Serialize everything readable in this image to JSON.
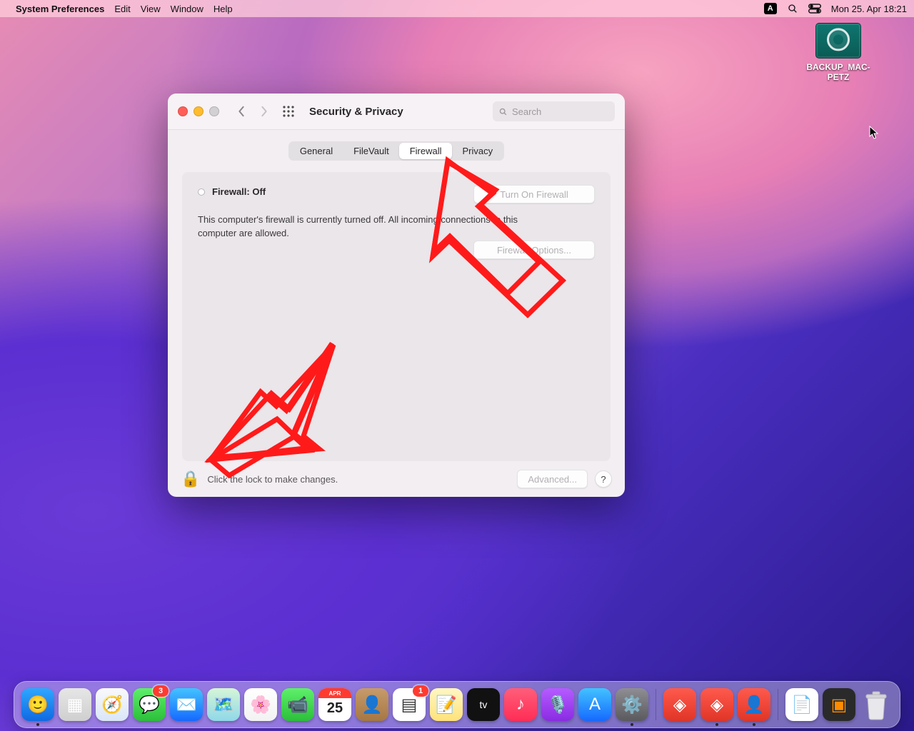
{
  "menubar": {
    "app_name": "System Preferences",
    "items": [
      "Edit",
      "View",
      "Window",
      "Help"
    ],
    "right": {
      "datetime": "Mon 25. Apr  18:21"
    }
  },
  "desktop_icons": [
    {
      "label": "BACKUP_MAC-PETZ"
    }
  ],
  "window": {
    "title": "Security & Privacy",
    "search_placeholder": "Search",
    "tabs": [
      "General",
      "FileVault",
      "Firewall",
      "Privacy"
    ],
    "selected_tab": "Firewall",
    "firewall": {
      "status_label": "Firewall: Off",
      "description": "This computer's firewall is currently turned off. All incoming connections to this computer are allowed.",
      "turn_on_button": "Turn On Firewall",
      "options_button": "Firewall Options..."
    },
    "footer": {
      "lock_hint": "Click the lock to make changes.",
      "advanced_button": "Advanced...",
      "help_label": "?"
    }
  },
  "dock": {
    "apps": [
      {
        "name": "finder",
        "bg": "linear-gradient(#2ea7ff,#1069e3)",
        "glyph": "🙂",
        "running": true
      },
      {
        "name": "launchpad",
        "bg": "linear-gradient(#e6e6e6,#cfcfcf)",
        "glyph": "▦"
      },
      {
        "name": "safari",
        "bg": "linear-gradient(#f9f9fb,#d9e6f7)",
        "glyph": "🧭"
      },
      {
        "name": "messages",
        "bg": "linear-gradient(#5ef06a,#2bbf3a)",
        "glyph": "💬",
        "badge": "3"
      },
      {
        "name": "mail",
        "bg": "linear-gradient(#42c3ff,#1669ff)",
        "glyph": "✉️"
      },
      {
        "name": "maps",
        "bg": "linear-gradient(#d6f5d6,#8fd8e8)",
        "glyph": "🗺️"
      },
      {
        "name": "photos",
        "bg": "linear-gradient(#ffffff,#f2f2f2)",
        "glyph": "🌸"
      },
      {
        "name": "facetime",
        "bg": "linear-gradient(#5ef06a,#2bbf3a)",
        "glyph": "📹"
      },
      {
        "name": "calendar",
        "bg": "#ffffff",
        "glyph": "25",
        "text_color": "#222",
        "top_strip": "#ff3b30",
        "top_text": "APR"
      },
      {
        "name": "contacts",
        "bg": "linear-gradient(#c79b6b,#a57743)",
        "glyph": "👤"
      },
      {
        "name": "reminders",
        "bg": "#ffffff",
        "glyph": "▤",
        "text_color": "#333",
        "badge": "1"
      },
      {
        "name": "notes",
        "bg": "linear-gradient(#fff7c2,#ffe27a)",
        "glyph": "📝"
      },
      {
        "name": "tv",
        "bg": "#111",
        "glyph": "tv",
        "text_color": "#fff",
        "small": true
      },
      {
        "name": "music",
        "bg": "linear-gradient(#ff5e7a,#ff2d55)",
        "glyph": "♪"
      },
      {
        "name": "podcasts",
        "bg": "linear-gradient(#b55cff,#8a2be2)",
        "glyph": "🎙️"
      },
      {
        "name": "appstore",
        "bg": "linear-gradient(#42c3ff,#1669ff)",
        "glyph": "A"
      },
      {
        "name": "systempreferences",
        "bg": "linear-gradient(#8e8e93,#5a5a5e)",
        "glyph": "⚙️",
        "running": true
      }
    ],
    "right_apps": [
      {
        "name": "anydesk-1",
        "bg": "linear-gradient(#ff5a4d,#e03527)",
        "glyph": "◈"
      },
      {
        "name": "anydesk-2",
        "bg": "linear-gradient(#ff5a4d,#e03527)",
        "glyph": "◈",
        "running": true
      },
      {
        "name": "anydesk-3",
        "bg": "linear-gradient(#ff5a4d,#e03527)",
        "glyph": "👤",
        "running": true
      }
    ],
    "docked": [
      {
        "name": "document-1",
        "bg": "#ffffff",
        "glyph": "📄",
        "text_color": "#333"
      },
      {
        "name": "document-2",
        "bg": "#2a2a2a",
        "glyph": "▣",
        "text_color": "#ff8c00"
      }
    ],
    "trash_label": "Trash"
  }
}
